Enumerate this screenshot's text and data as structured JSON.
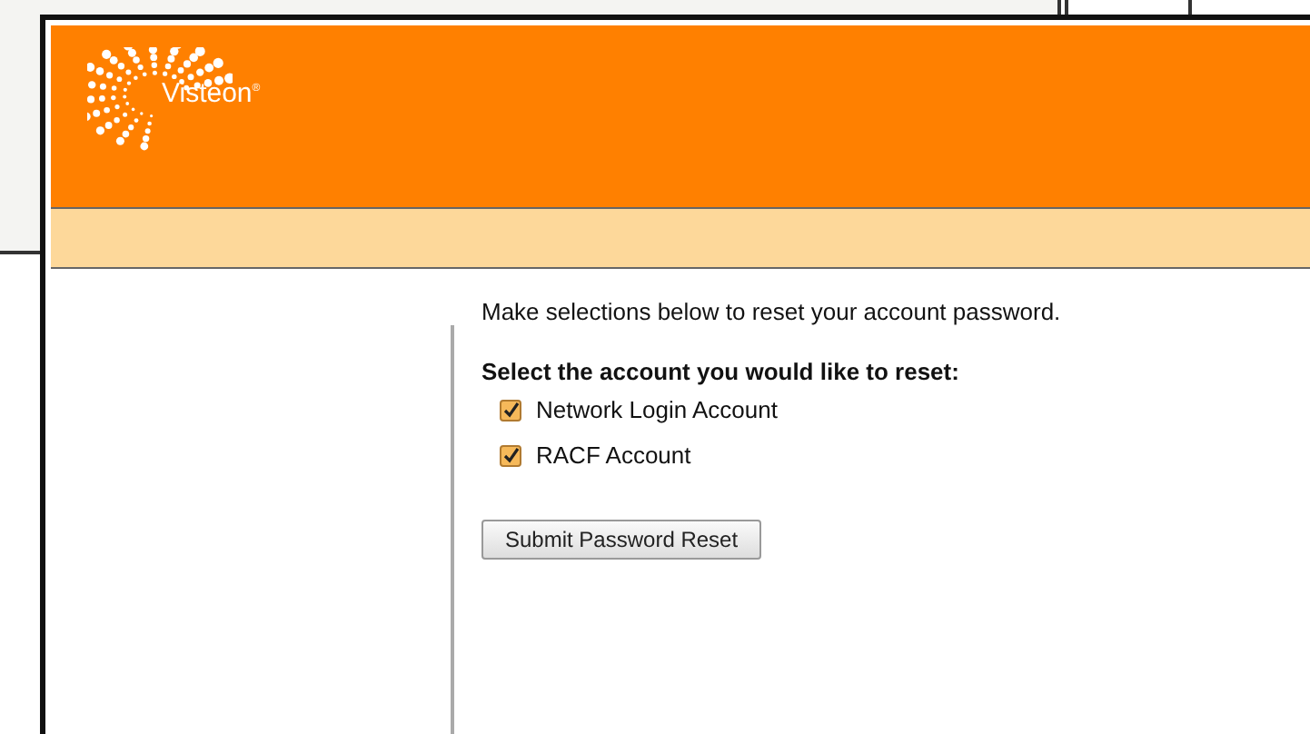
{
  "header": {
    "logo_text": "Visteon",
    "logo_mark": "®"
  },
  "content": {
    "intro": "Make selections below to reset your account password.",
    "prompt": "Select the account you would like to reset:",
    "accounts": [
      {
        "label": "Network Login Account",
        "checked": true
      },
      {
        "label": "RACF Account",
        "checked": true
      }
    ],
    "submit_button": "Submit Password Reset"
  }
}
